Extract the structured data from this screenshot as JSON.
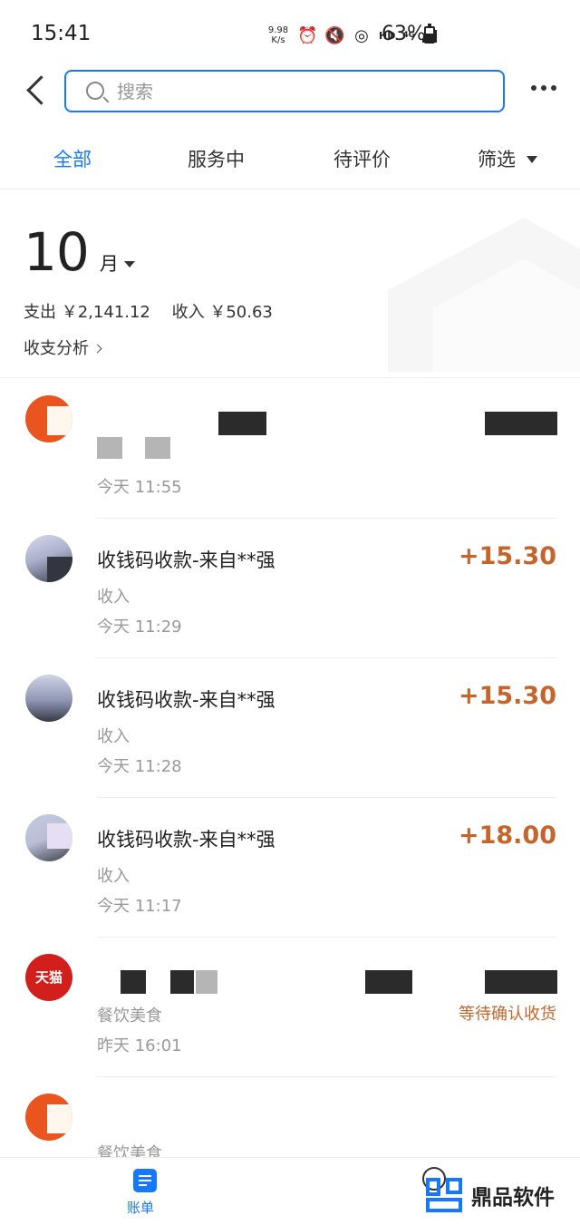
{
  "status_bar": {
    "time": "15:41",
    "speed": "9.98\nK/s",
    "hd": "HD",
    "net": "4G",
    "battery": "63%"
  },
  "search": {
    "placeholder": "搜索"
  },
  "tabs": [
    {
      "label": "全部",
      "active": true
    },
    {
      "label": "服务中",
      "active": false
    },
    {
      "label": "待评价",
      "active": false
    },
    {
      "label": "筛选",
      "active": false
    }
  ],
  "summary": {
    "month": "10",
    "month_unit": "月",
    "expense": "支出 ￥2,141.12",
    "income": "收入 ￥50.63",
    "analysis": "收支分析"
  },
  "transactions": [
    {
      "title": "",
      "amount": "",
      "category": "",
      "time": "今天 11:55",
      "avatar": "orange"
    },
    {
      "title": "收钱码收款-来自**强",
      "amount": "+15.30",
      "category": "收入",
      "time": "今天 11:29",
      "avatar": "photo"
    },
    {
      "title": "收钱码收款-来自**强",
      "amount": "+15.30",
      "category": "收入",
      "time": "今天 11:28",
      "avatar": "photo2"
    },
    {
      "title": "收钱码收款-来自**强",
      "amount": "+18.00",
      "category": "收入",
      "time": "今天 11:17",
      "avatar": "photo3"
    },
    {
      "title": "",
      "amount": "",
      "category": "餐饮美食",
      "time": "昨天 16:01",
      "status": "等待确认收货",
      "avatar": "tmall",
      "avatar_text": "天猫"
    },
    {
      "title": "",
      "amount": "",
      "category": "餐饮美食",
      "time": "",
      "avatar": "orange"
    }
  ],
  "bottom_nav": {
    "label": "账单"
  },
  "watermark": {
    "text": "鼎品软件"
  },
  "colors": {
    "accent": "#1677ff",
    "amount": "#c5652c"
  }
}
